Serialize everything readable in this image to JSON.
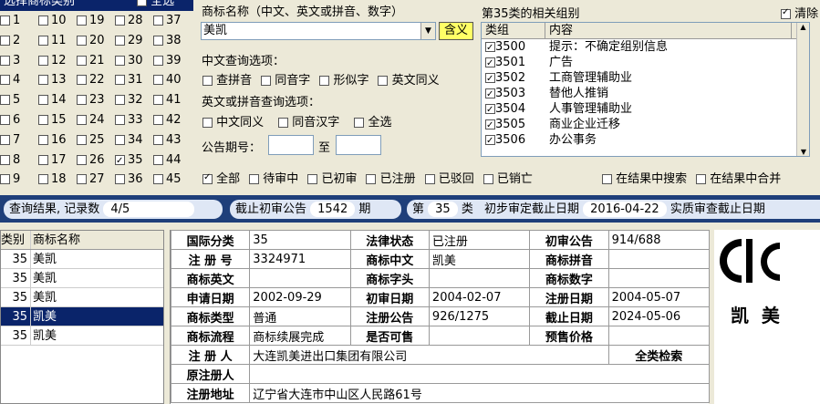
{
  "categories": {
    "title": "选择商标类别",
    "select_all": "全选",
    "columns": [
      [
        "1",
        "2",
        "3",
        "4",
        "5",
        "6",
        "7",
        "8",
        "9"
      ],
      [
        "10",
        "11",
        "12",
        "13",
        "14",
        "15",
        "16",
        "17",
        "18"
      ],
      [
        "19",
        "20",
        "21",
        "22",
        "23",
        "24",
        "25",
        "26",
        "27"
      ],
      [
        "28",
        "29",
        "30",
        "31",
        "32",
        "33",
        "34",
        "35",
        "36"
      ],
      [
        "37",
        "38",
        "39",
        "40",
        "41",
        "42",
        "43",
        "44",
        "45"
      ]
    ],
    "checked": "35"
  },
  "search": {
    "name_label": "商标名称（中文、英文或拼音、数字）",
    "name_value": "美凯",
    "meaning_button": "含义",
    "cn_options_label": "中文查询选项：",
    "cn_options": [
      "查拼音",
      "同音字",
      "形似字",
      "英文同义"
    ],
    "en_options_label": "英文或拼音查询选项：",
    "en_options": [
      "中文同义",
      "同音汉字",
      "全选"
    ],
    "period_label": "公告期号：",
    "period_to": "至"
  },
  "groups": {
    "title": "第35类的相关组别",
    "clear_label": "清除",
    "col_group": "类组",
    "col_content": "内容",
    "rows": [
      {
        "code": "3500",
        "text": "提示：不确定组别信息"
      },
      {
        "code": "3501",
        "text": "广告"
      },
      {
        "code": "3502",
        "text": "工商管理辅助业"
      },
      {
        "code": "3503",
        "text": "替他人推销"
      },
      {
        "code": "3504",
        "text": "人事管理辅助业"
      },
      {
        "code": "3505",
        "text": "商业企业迁移"
      },
      {
        "code": "3506",
        "text": "办公事务"
      }
    ]
  },
  "filters": [
    "全部",
    "待审中",
    "已初审",
    "已注册",
    "已驳回",
    "已销亡"
  ],
  "filter_checked": "全部",
  "extra_filters": [
    "在结果中搜索",
    "在结果中合并"
  ],
  "results_bar": {
    "query_label": "查询结果, 记录数",
    "count": "4/5",
    "deadline_label": "截止初审公告",
    "deadline_period": "1542",
    "period_unit": "期",
    "class_prefix": "第",
    "class_value": "35",
    "class_suffix": "类",
    "prelim_label": "初步审定截止日期",
    "prelim_date": "2016-04-22",
    "substantive_label": "实质审查截止日期"
  },
  "result_list": {
    "col_class": "类别",
    "col_name": "商标名称",
    "rows": [
      {
        "cls": "35",
        "name": "美凯",
        "selected": false
      },
      {
        "cls": "35",
        "name": "美凯",
        "selected": false
      },
      {
        "cls": "35",
        "name": "美凯",
        "selected": false
      },
      {
        "cls": "35",
        "name": "凯美",
        "selected": true
      },
      {
        "cls": "35",
        "name": "凯美",
        "selected": false
      }
    ]
  },
  "detail": {
    "r1": [
      "国际分类",
      "35",
      "法律状态",
      "已注册",
      "初审公告",
      "914/688"
    ],
    "r2": [
      "注 册 号",
      "3324971",
      "商标中文",
      "凯美",
      "商标拼音",
      ""
    ],
    "r3": [
      "商标英文",
      "",
      "商标字头",
      "",
      "商标数字",
      ""
    ],
    "r4": [
      "申请日期",
      "2002-09-29",
      "初审日期",
      "2004-02-07",
      "注册日期",
      "2004-05-07"
    ],
    "r5": [
      "商标类型",
      "普通",
      "注册公告",
      "926/1275",
      "截止日期",
      "2024-05-06"
    ],
    "r6": [
      "商标流程",
      "商标续展完成",
      "是否可售",
      "",
      "预售价格",
      ""
    ],
    "applicant_label": "注 册 人",
    "applicant": "大连凯美进出口集团有限公司",
    "search_all": "全类检索",
    "original_label": "原注册人",
    "original": "",
    "address_label": "注册地址",
    "address": "辽宁省大连市中山区人民路61号"
  },
  "logo_text": "凯  美"
}
